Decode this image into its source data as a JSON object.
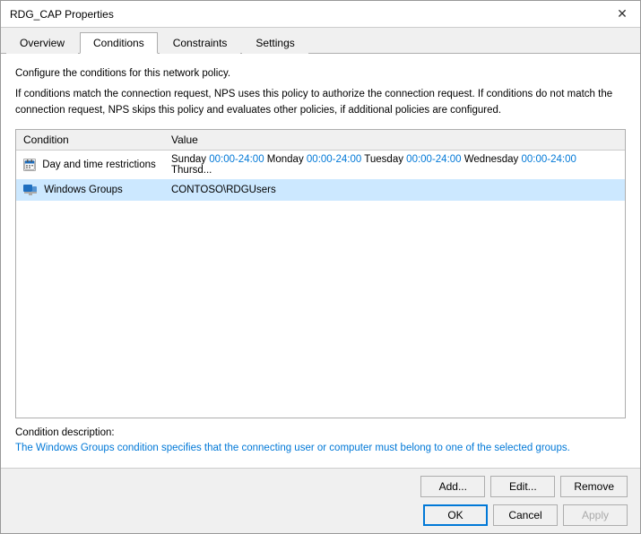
{
  "window": {
    "title": "RDG_CAP Properties",
    "close_label": "✕"
  },
  "tabs": [
    {
      "label": "Overview",
      "active": false
    },
    {
      "label": "Conditions",
      "active": true
    },
    {
      "label": "Constraints",
      "active": false
    },
    {
      "label": "Settings",
      "active": false
    }
  ],
  "description_line1": "Configure the conditions for this network policy.",
  "description_line2": "If conditions match the connection request, NPS uses this policy to authorize the connection request. If conditions do not match the connection request, NPS skips this policy and evaluates other policies, if additional policies are configured.",
  "table": {
    "columns": [
      {
        "label": "Condition"
      },
      {
        "label": "Value"
      }
    ],
    "rows": [
      {
        "condition": "Day and time restrictions",
        "value_plain": "Sunday 00:00-24:00 Monday ",
        "value_highlight": "00:00-24:00",
        "value_rest": " Tuesday ",
        "value_highlight2": "00:00-24:00",
        "value_rest2": " Wednesday ",
        "value_highlight3": "00:00-24:00",
        "value_rest3": " Thursd...",
        "full_value": "Sunday 00:00-24:00 Monday 00:00-24:00 Tuesday 00:00-24:00 Wednesday 00:00-24:00 Thursd...",
        "icon_type": "calendar"
      },
      {
        "condition": "Windows Groups",
        "value": "CONTOSO\\RDGUsers",
        "icon_type": "group"
      }
    ]
  },
  "condition_desc": {
    "label": "Condition description:",
    "value": "The Windows Groups condition specifies that the connecting user or computer must belong to one of the selected groups."
  },
  "buttons": {
    "add": "Add...",
    "edit": "Edit...",
    "remove": "Remove",
    "ok": "OK",
    "cancel": "Cancel",
    "apply": "Apply"
  }
}
